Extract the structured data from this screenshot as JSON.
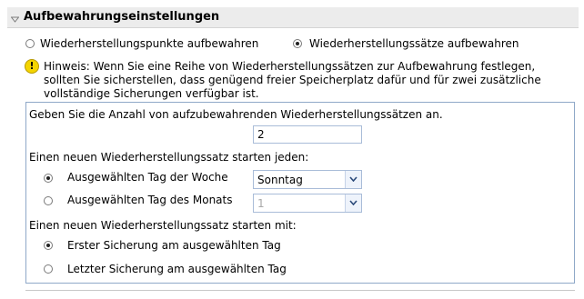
{
  "header": {
    "title": "Aufbewahrungseinstellungen"
  },
  "retention_mode": {
    "option_points": "Wiederherstellungspunkte aufbewahren",
    "option_sets": "Wiederherstellungssätze aufbewahren",
    "selected": "sets"
  },
  "note": {
    "text": "Hinweis: Wenn Sie eine Reihe von Wiederherstellungssätzen zur Aufbewahrung festlegen, sollten Sie sicherstellen, dass genügend freier Speicherplatz dafür und für zwei zusätzliche vollständige Sicherungen verfügbar ist."
  },
  "count": {
    "label": "Geben Sie die Anzahl von aufzubewahrenden Wiederherstellungssätzen an.",
    "value": "2"
  },
  "start_every": {
    "label": "Einen neuen Wiederherstellungssatz starten jeden:",
    "weekday_label": "Ausgewählten Tag der Woche",
    "weekday_value": "Sonntag",
    "monthday_label": "Ausgewählten Tag des Monats",
    "monthday_value": "1",
    "selected": "weekday"
  },
  "start_with": {
    "label": "Einen neuen Wiederherstellungssatz starten mit:",
    "first_label": "Erster Sicherung am ausgewählten Tag",
    "last_label": "Letzter Sicherung am ausgewählten Tag",
    "selected": "first"
  },
  "icons": {
    "chevron": "chevron-down-icon",
    "warning": "warning-icon",
    "dropdown_arrow": "dropdown-arrow-icon"
  },
  "colors": {
    "header_bg": "#ececec",
    "group_border": "#8fa8c8",
    "warning_fill": "#f4d400"
  }
}
